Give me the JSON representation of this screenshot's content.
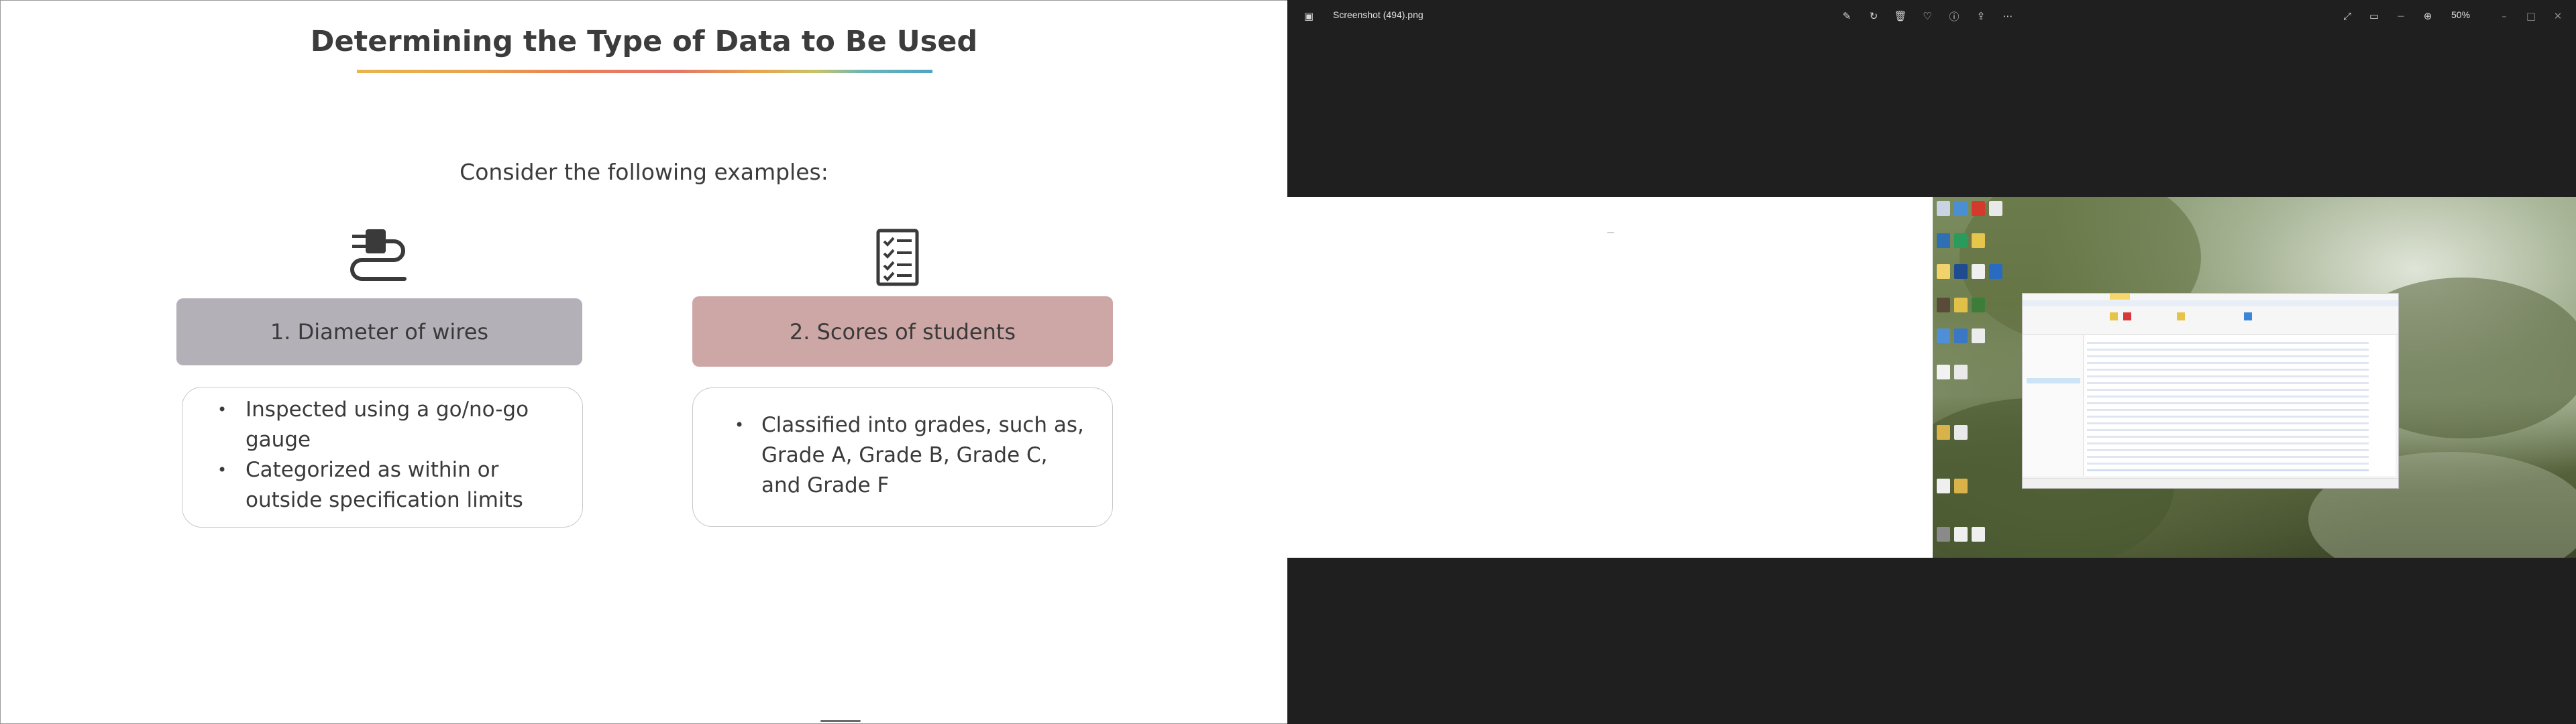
{
  "slide": {
    "title": "Determining the Type of Data to Be Used",
    "subtitle": "Consider the following examples:",
    "examples": [
      {
        "icon": "plug-cable-icon",
        "header": "1. Diameter of wires",
        "header_color": "#b3b1b7",
        "bullets": [
          "Inspected using a go/no-go gauge",
          "Categorized as within or outside specification limits"
        ]
      },
      {
        "icon": "checklist-icon",
        "header": "2. Scores of students",
        "header_color": "#cda6a6",
        "bullets": [
          "Classified into grades, such as, Grade A, Grade B, Grade C, and Grade F"
        ]
      }
    ]
  },
  "viewer": {
    "file_name": "Screenshot (494).png",
    "zoom": "50%",
    "toolbar_icons": [
      "edit-icon",
      "rotate-icon",
      "delete-icon",
      "favorite-icon",
      "info-icon",
      "share-icon",
      "more-icon"
    ],
    "window_icons": [
      "fullscreen-icon",
      "slideshow-icon",
      "zoom-out-icon",
      "zoom-in-icon",
      "minimize-icon",
      "maximize-icon",
      "close-icon"
    ],
    "background_color": "#1f1f1f"
  }
}
